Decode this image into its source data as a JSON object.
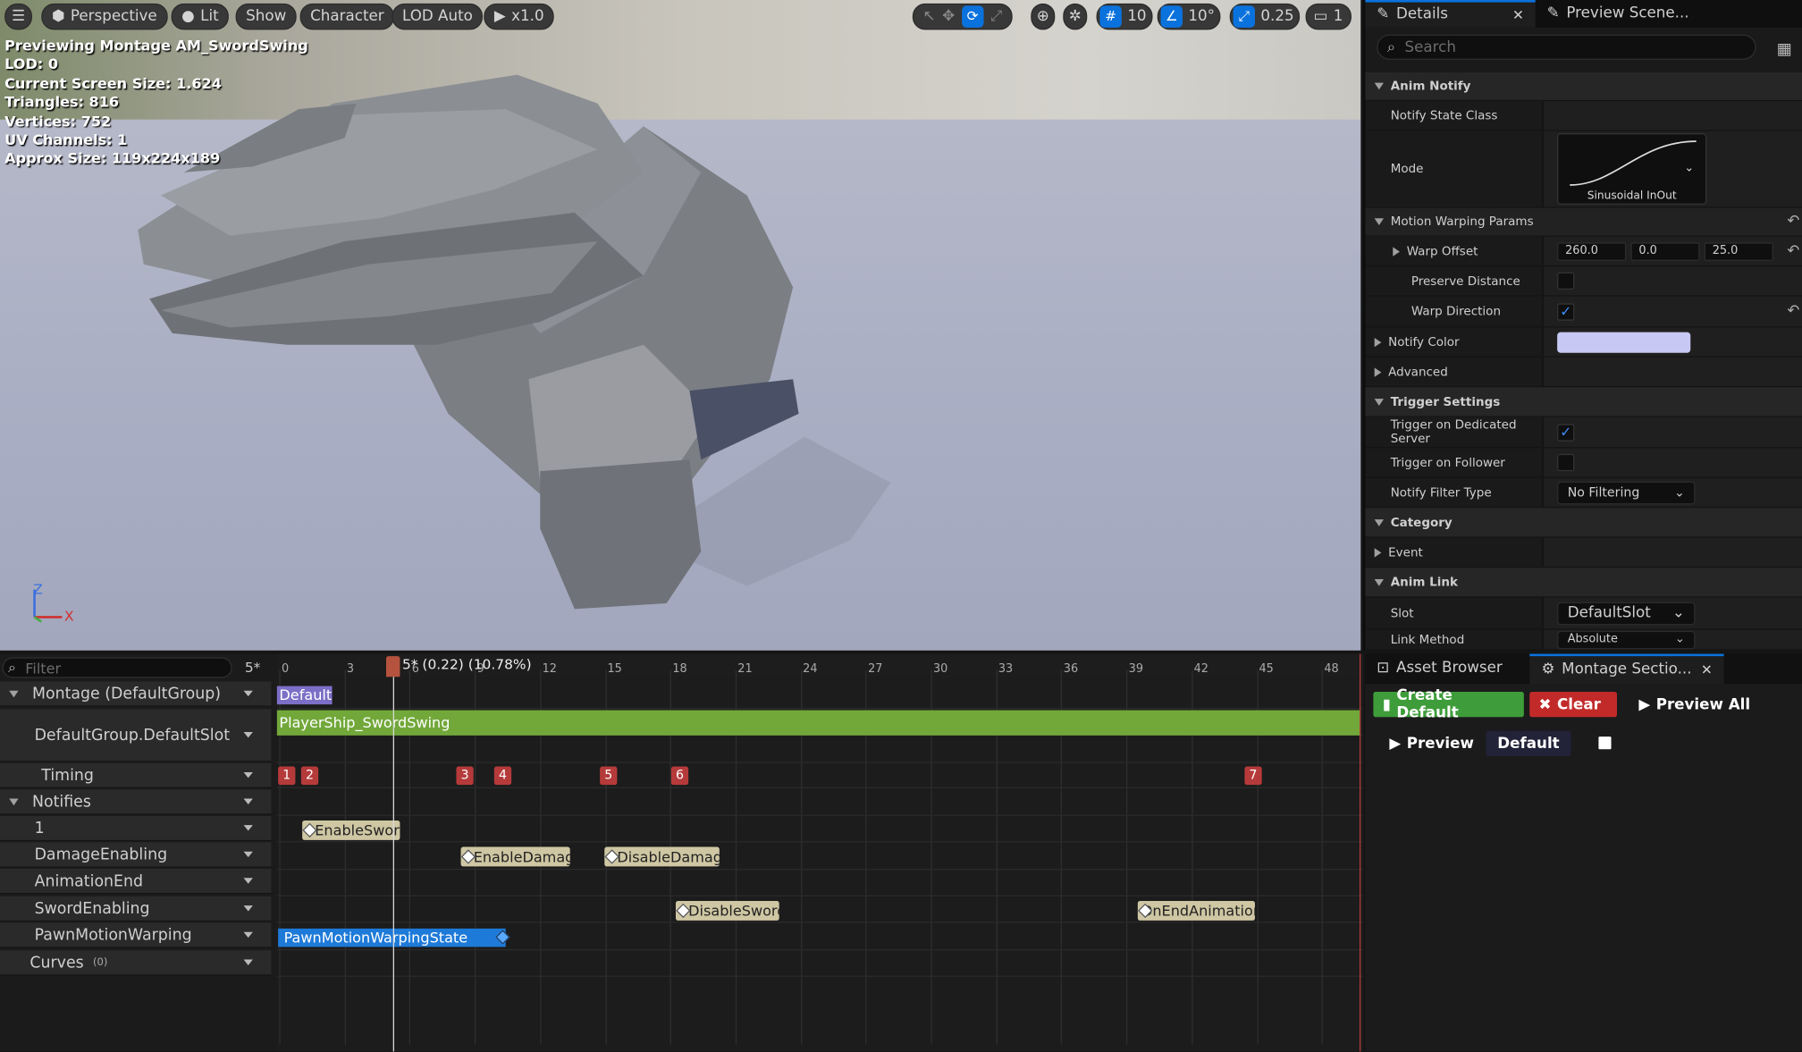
{
  "viewport": {
    "toolbar": {
      "perspective": "Perspective",
      "lit": "Lit",
      "show": "Show",
      "character": "Character",
      "lod": "LOD Auto",
      "speed": "x1.0",
      "grid_snap": "10",
      "rot_snap": "10°",
      "scale_snap": "0.25",
      "camera": "1"
    },
    "stats": [
      "Previewing Montage AM_SwordSwing",
      "LOD: 0",
      "Current Screen Size: 1.624",
      "Triangles: 816",
      "Vertices: 752",
      "UV Channels: 1",
      "Approx Size: 119x224x189"
    ],
    "axis": {
      "z": "Z",
      "x": "X"
    }
  },
  "details": {
    "tabs": {
      "details": "Details",
      "preview": "Preview Scene..."
    },
    "search_placeholder": "Search",
    "rows": {
      "anim_notify": "Anim Notify",
      "notify_state_class": "Notify State Class",
      "mode": "Mode",
      "mode_value": "Sinusoidal InOut",
      "mwp": "Motion Warping Params",
      "warp_offset": "Warp Offset",
      "warp_x": "260.0",
      "warp_y": "0.0",
      "warp_z": "25.0",
      "preserve_distance": "Preserve Distance",
      "warp_direction": "Warp Direction",
      "notify_color": "Notify Color",
      "advanced": "Advanced",
      "trigger_settings": "Trigger Settings",
      "dedicated_server": "Trigger on Dedicated Server",
      "follower": "Trigger on Follower",
      "filter_type": "Notify Filter Type",
      "filter_value": "No Filtering",
      "category": "Category",
      "event": "Event",
      "anim_link": "Anim Link",
      "slot": "Slot",
      "slot_value": "DefaultSlot",
      "link_method": "Link Method",
      "link_value": "Absolute"
    },
    "notify_color_hex": "#c8c8f5"
  },
  "timeline": {
    "filter_placeholder": "Filter",
    "fps_label": "5*",
    "playhead_label": "5* (0.22) (10.78%)",
    "ticks": [
      "0",
      "3",
      "6",
      "9",
      "12",
      "15",
      "18",
      "21",
      "24",
      "27",
      "30",
      "33",
      "36",
      "39",
      "42",
      "45",
      "48"
    ],
    "tracks": {
      "montage": "Montage (DefaultGroup)",
      "slot": "DefaultGroup.DefaultSlot",
      "timing": "Timing",
      "notifies": "Notifies",
      "n1": "1",
      "damage": "DamageEnabling",
      "anim_end": "AnimationEnd",
      "sword": "SwordEnabling",
      "pawn": "PawnMotionWarping",
      "curves": "Curves",
      "curves_count": "(0)"
    },
    "section_label": "Default",
    "segment_label": "PlayerShip_SwordSwing",
    "timing_markers": [
      "1",
      "2",
      "3",
      "4",
      "5",
      "6",
      "7"
    ],
    "notifies": {
      "enable_sword": "EnableSword",
      "enable_damage": "EnableDamage",
      "disable_damage": "DisableDamage",
      "disable_sword": "DisableSword",
      "on_end": "OnEndAnimation",
      "pawn_state": "PawnMotionWarpingState"
    }
  },
  "lower_right": {
    "tabs": {
      "asset_browser": "Asset Browser",
      "montage_sections": "Montage Sectio..."
    },
    "create_default": "Create Default",
    "clear": "Clear",
    "preview_all": "Preview All",
    "preview": "Preview",
    "default_section": "Default"
  }
}
